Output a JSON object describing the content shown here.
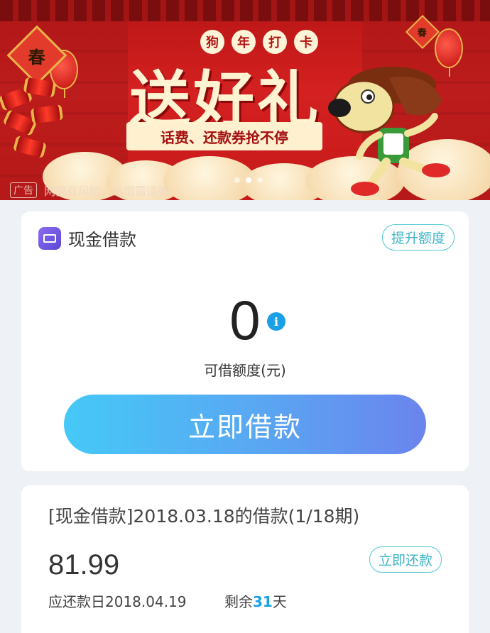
{
  "banner": {
    "title_small": [
      "狗",
      "年",
      "打",
      "卡"
    ],
    "title_big": "送好礼",
    "ribbon": "话费、还款券抢不停",
    "chun_left": "春",
    "chun_right": "春",
    "ad_tag": "广告",
    "ad_text": "网贷有风险，出借需谨慎",
    "carousel_active": 1
  },
  "loan_card": {
    "title": "现金借款",
    "raise_button": "提升额度",
    "amount": "0",
    "info_icon": "i",
    "amount_label": "可借额度(元)",
    "borrow_button": "立即借款"
  },
  "bill_card": {
    "title": "[现金借款]2018.03.18的借款(1/18期)",
    "amount": "81.99",
    "repay_button": "立即还款",
    "due_date": "应还款日2018.04.19",
    "remain_prefix": "剩余",
    "remain_days": "31",
    "remain_suffix": "天"
  },
  "colors": {
    "banner_red": "#d42020",
    "accent_teal": "#3db4c6",
    "info_blue": "#1aa0e8",
    "button_gradient_start": "#45c9f7",
    "button_gradient_end": "#6b84ee"
  }
}
